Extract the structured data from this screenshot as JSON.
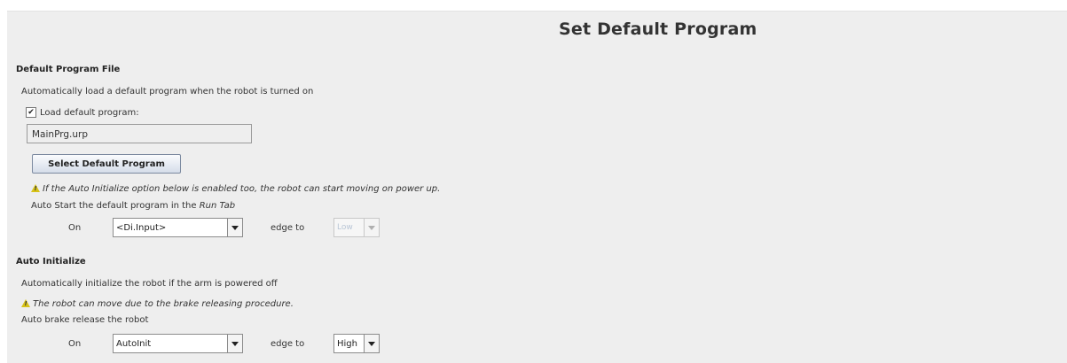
{
  "title": "Set Default Program",
  "default_program": {
    "section_title": "Default Program File",
    "description": "Automatically load a default program when the robot is turned on",
    "checkbox_label": "Load default program:",
    "checkbox_checked": true,
    "file_value": "MainPrg.urp",
    "select_button": "Select Default Program",
    "warning": "If the Auto Initialize option below is enabled too, the robot can start moving on power up.",
    "autostart_prefix": "Auto Start the default program in the",
    "autostart_tab": "Run Tab",
    "on_label": "On",
    "input_value": "<Di.Input>",
    "edge_label": "edge to",
    "edge_value": "Low"
  },
  "auto_initialize": {
    "section_title": "Auto Initialize",
    "description": "Automatically initialize the robot if the arm is powered off",
    "warning": "The robot can move due to the brake releasing procedure.",
    "brake_text": "Auto brake release the robot",
    "on_label": "On",
    "input_value": "AutoInit",
    "edge_label": "edge to",
    "edge_value": "High"
  },
  "colors": {
    "panel_bg": "#eeeeee",
    "warning_icon": "#d7c217"
  }
}
